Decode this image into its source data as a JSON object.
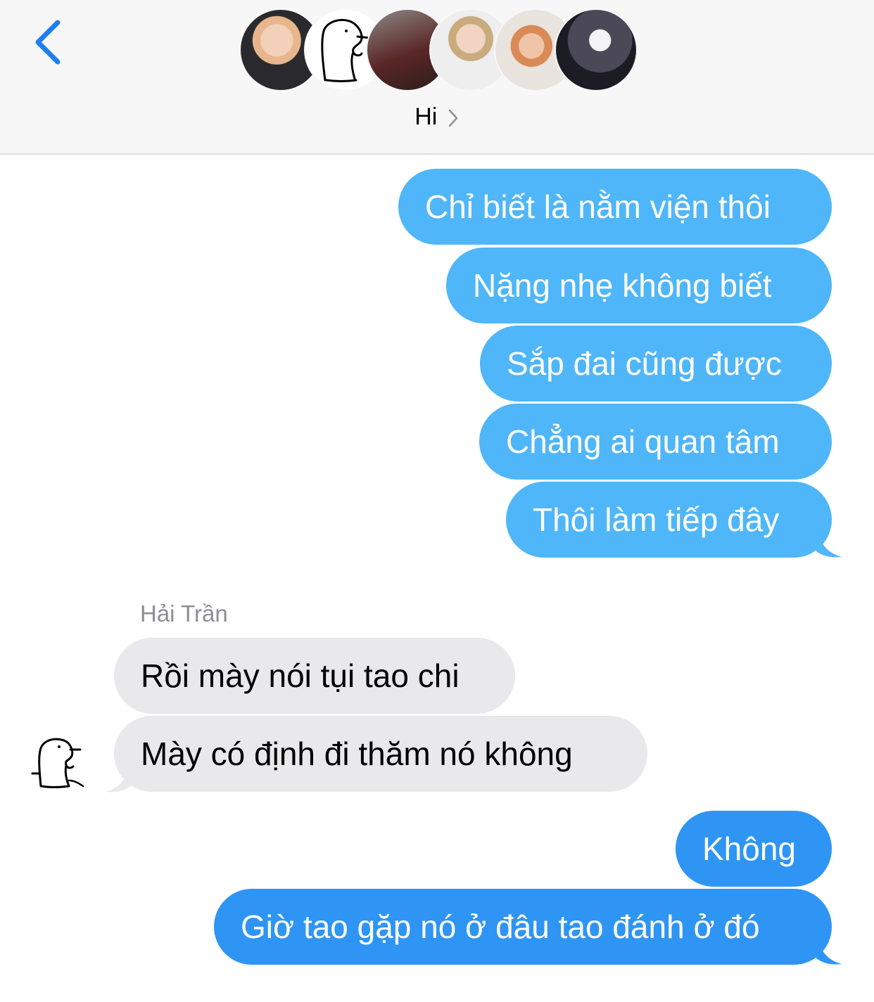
{
  "header": {
    "group_name": "Hi",
    "back_icon": "chevron-left-icon",
    "disclosure_icon": "chevron-right-icon",
    "participants": [
      {
        "avatar": "participant-avatar-1"
      },
      {
        "avatar": "participant-avatar-2-drawing"
      },
      {
        "avatar": "participant-avatar-3"
      },
      {
        "avatar": "participant-avatar-4"
      },
      {
        "avatar": "participant-avatar-5"
      },
      {
        "avatar": "participant-avatar-6"
      }
    ]
  },
  "colors": {
    "outgoing_light": "#4fb6f9",
    "outgoing_blue": "#2e95f4",
    "incoming": "#e9e9eb",
    "accent": "#1f7ef1",
    "sender_name": "#8e8e93"
  },
  "messages": {
    "outgoing_group_1": [
      "Chỉ biết là nằm viện thôi",
      "Nặng nhẹ không biết",
      "Sắp đai cũng được",
      "Chẳng ai quan tâm",
      "Thôi làm tiếp đây"
    ],
    "incoming_group": {
      "sender": "Hải Trần",
      "items": [
        "Rồi mày nói tụi tao chi",
        "Mày có định đi thăm nó không"
      ]
    },
    "outgoing_group_2": [
      "Không",
      "Giờ tao gặp nó ở đâu tao đánh ở đó"
    ]
  }
}
